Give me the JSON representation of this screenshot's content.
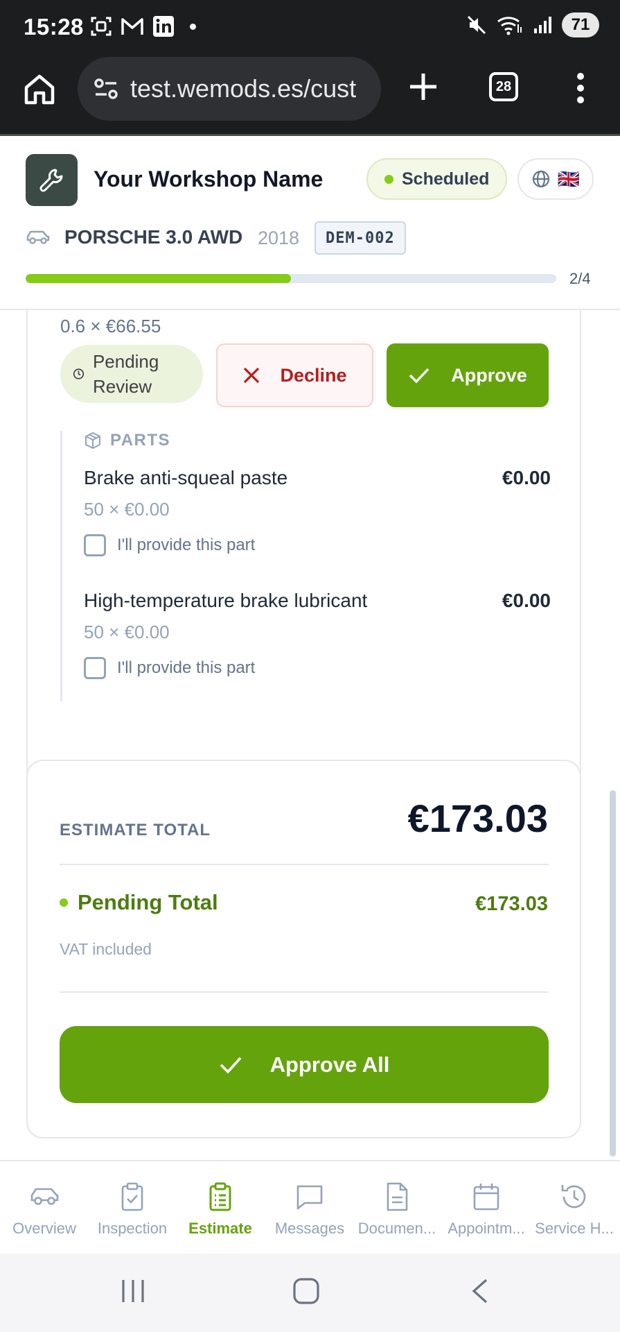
{
  "status_bar": {
    "time": "15:28",
    "battery": "71"
  },
  "browser": {
    "url": "test.wemods.es/cust",
    "tab_count": "28"
  },
  "header": {
    "workshop_name": "Your Workshop Name",
    "status": "Scheduled",
    "language_flag": "🇬🇧",
    "vehicle_model": "PORSCHE 3.0 AWD",
    "vehicle_year": "2018",
    "plate": "DEM-002",
    "progress_label": "2/4",
    "progress_fraction": 0.5
  },
  "estimate_item": {
    "partial_line": "0.6 × €66.55",
    "status_badge": "Pending Review",
    "decline_label": "Decline",
    "approve_label": "Approve",
    "parts_heading": "PARTS",
    "parts": [
      {
        "name": "Brake anti-squeal paste",
        "price": "€0.00",
        "qty": "50 × €0.00",
        "provide_label": "I'll provide this part"
      },
      {
        "name": "High-temperature brake lubricant",
        "price": "€0.00",
        "qty": "50 × €0.00",
        "provide_label": "I'll provide this part"
      }
    ]
  },
  "totals": {
    "estimate_label": "ESTIMATE TOTAL",
    "estimate_value": "€173.03",
    "pending_label": "Pending Total",
    "pending_value": "€173.03",
    "vat_note": "VAT included",
    "approve_all_label": "Approve All"
  },
  "bottom_nav": [
    {
      "label": "Overview",
      "icon": "car-icon"
    },
    {
      "label": "Inspection",
      "icon": "clipboard-check-icon"
    },
    {
      "label": "Estimate",
      "icon": "clipboard-list-icon",
      "active": true
    },
    {
      "label": "Messages",
      "icon": "message-icon"
    },
    {
      "label": "Documen...",
      "icon": "document-icon"
    },
    {
      "label": "Appointm...",
      "icon": "calendar-icon"
    },
    {
      "label": "Service H...",
      "icon": "history-icon"
    }
  ],
  "colors": {
    "accent": "#65a30d",
    "accent_light": "#84cc16",
    "decline": "#b91c1c"
  }
}
